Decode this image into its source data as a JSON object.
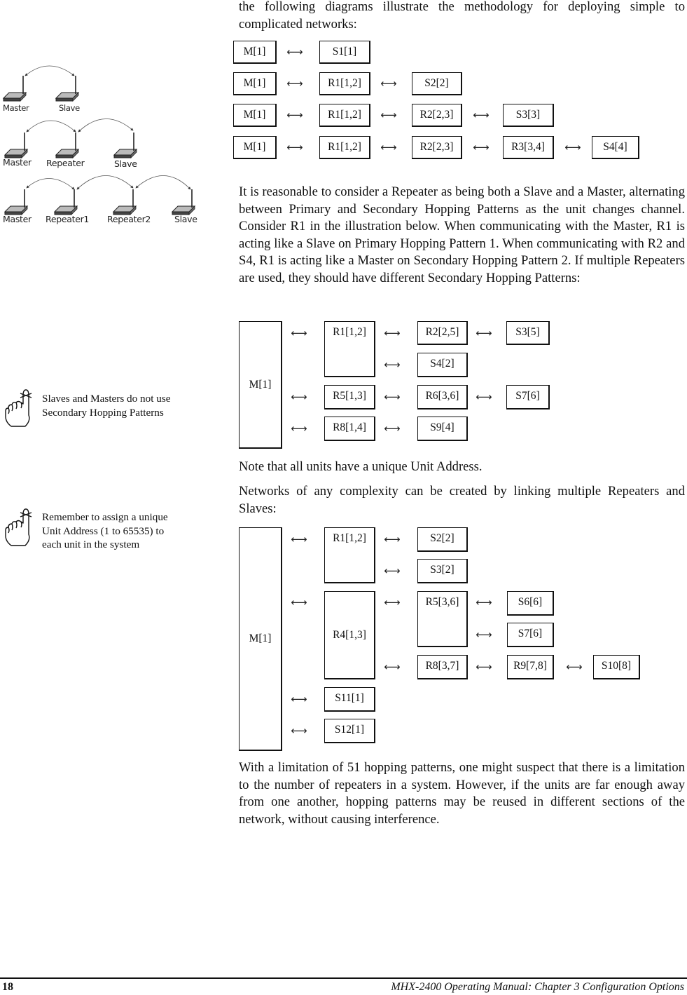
{
  "intro_text": "the following diagrams illustrate the methodology for deploying simple to complicated networks:",
  "arrow_glyph": "←→",
  "left_column": {
    "topologies": [
      {
        "devices": [
          "Master",
          "Slave"
        ]
      },
      {
        "devices": [
          "Master",
          "Repeater",
          "Slave"
        ]
      },
      {
        "devices": [
          "Master",
          "Repeater1",
          "Repeater2",
          "Slave"
        ]
      }
    ],
    "notes": [
      {
        "icon": "hand-pointing-tied-finger-icon",
        "text": "Slaves and Masters do not use Secondary Hopping Patterns"
      },
      {
        "icon": "hand-pointing-tied-finger-icon",
        "text": "Remember to assign a unique Unit Address (1 to 65535) to each unit in the system"
      }
    ]
  },
  "chain_diagram": {
    "rows": [
      [
        "M[1]",
        "S1[1]"
      ],
      [
        "M[1]",
        "R1[1,2]",
        "S2[2]"
      ],
      [
        "M[1]",
        "R1[1,2]",
        "R2[2,3]",
        "S3[3]"
      ],
      [
        "M[1]",
        "R1[1,2]",
        "R2[2,3]",
        "R3[3,4]",
        "S4[4]"
      ]
    ]
  },
  "paragraph_repeater": "It is reasonable to consider a Repeater as being both a Slave and a Master, alternating between Primary and Secondary Hopping Patterns as the unit changes channel.  Consider R1 in the illustration below.  When communicating with the Master, R1 is acting like a Slave on Primary Hopping Pattern 1.  When communicating with R2 and S4, R1 is acting like a Master on Secondary Hopping Pattern 2.  If multiple Repeaters are used, they should have different Secondary Hopping Patterns:",
  "tree_diagram_1": {
    "master": "M[1]",
    "nodes": {
      "r1": "R1[1,2]",
      "r2": "R2[2,5]",
      "s3": "S3[5]",
      "s4": "S4[2]",
      "r5": "R5[1,3]",
      "r6": "R6[3,6]",
      "s7": "S7[6]",
      "r8": "R8[1,4]",
      "s9": "S9[4]"
    }
  },
  "note_unique_address": "Note that all units have a unique Unit Address.",
  "paragraph_complexity": "Networks of any complexity can be created by linking multiple Repeaters and Slaves:",
  "tree_diagram_2": {
    "master": "M[1]",
    "nodes": {
      "r1": "R1[1,2]",
      "s2": "S2[2]",
      "s3": "S3[2]",
      "r4": "R4[1,3]",
      "r5": "R5[3,6]",
      "s6": "S6[6]",
      "s7": "S7[6]",
      "r8": "R8[3,7]",
      "r9": "R9[7,8]",
      "s10": "S10[8]",
      "s11": "S11[1]",
      "s12": "S12[1]"
    }
  },
  "paragraph_limitation": "With a limitation of 51 hopping patterns, one might suspect that there is a limitation to the number of repeaters in a system.  However, if the units are far enough away from one another, hopping patterns may be reused in different sections of the network, without causing interference.",
  "footer": {
    "page_number": "18",
    "title": "MHX-2400 Operating Manual: Chapter 3 Configuration Options"
  }
}
